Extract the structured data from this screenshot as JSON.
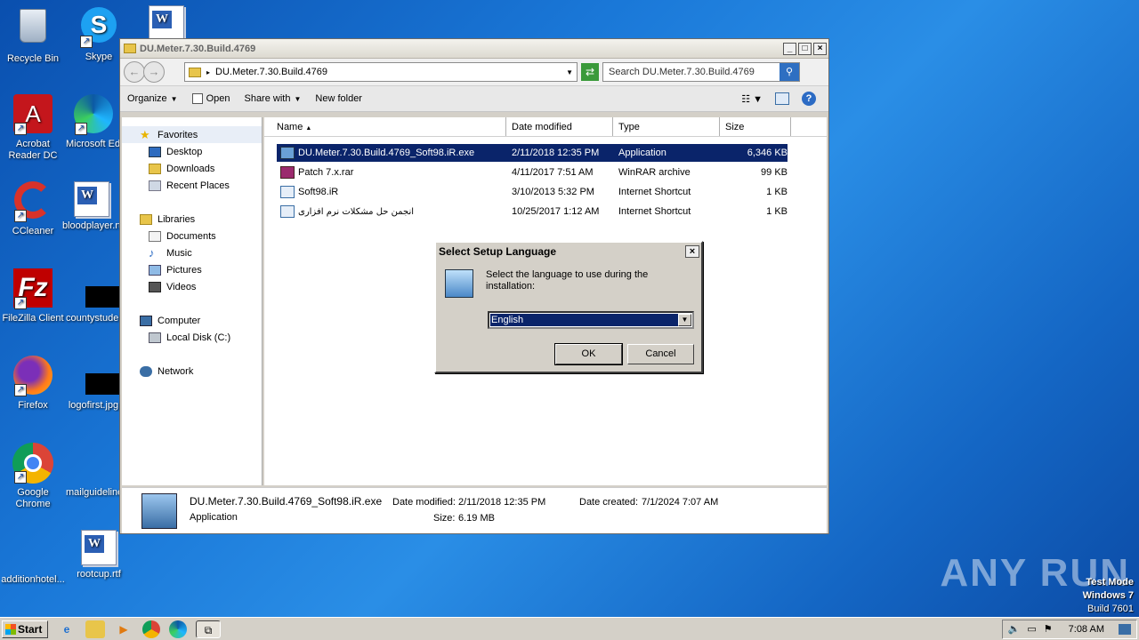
{
  "desktop": {
    "icons": [
      {
        "label": "Recycle Bin"
      },
      {
        "label": "Skype"
      },
      {
        "label": "Acrobat Reader DC"
      },
      {
        "label": "Microsoft Edge"
      },
      {
        "label": "CCleaner"
      },
      {
        "label": "bloodplayer.rtf"
      },
      {
        "label": "FileZilla Client"
      },
      {
        "label": "countystudent"
      },
      {
        "label": "Firefox"
      },
      {
        "label": "logofirst.jpg"
      },
      {
        "label": "Google Chrome"
      },
      {
        "label": "mailguidelines"
      },
      {
        "label": "additionhotel..."
      },
      {
        "label": "rootcup.rtf"
      }
    ]
  },
  "window": {
    "title": "DU.Meter.7.30.Build.4769",
    "address": "DU.Meter.7.30.Build.4769",
    "search_placeholder": "Search DU.Meter.7.30.Build.4769",
    "toolbar": {
      "organize": "Organize",
      "open": "Open",
      "share_with": "Share with",
      "new_folder": "New folder"
    },
    "nav": {
      "favorites": "Favorites",
      "desktop": "Desktop",
      "downloads": "Downloads",
      "recent": "Recent Places",
      "libraries": "Libraries",
      "documents": "Documents",
      "music": "Music",
      "pictures": "Pictures",
      "videos": "Videos",
      "computer": "Computer",
      "local_disk": "Local Disk (C:)",
      "network": "Network"
    },
    "columns": {
      "name": "Name",
      "date": "Date modified",
      "type": "Type",
      "size": "Size"
    },
    "files": [
      {
        "name": "DU.Meter.7.30.Build.4769_Soft98.iR.exe",
        "date": "2/11/2018 12:35 PM",
        "type": "Application",
        "size": "6,346 KB"
      },
      {
        "name": "Patch 7.x.rar",
        "date": "4/11/2017 7:51 AM",
        "type": "WinRAR archive",
        "size": "99 KB"
      },
      {
        "name": "Soft98.iR",
        "date": "3/10/2013 5:32 PM",
        "type": "Internet Shortcut",
        "size": "1 KB"
      },
      {
        "name": "انجمن حل مشکلات نرم افزاری",
        "date": "10/25/2017 1:12 AM",
        "type": "Internet Shortcut",
        "size": "1 KB"
      }
    ],
    "details": {
      "name": "DU.Meter.7.30.Build.4769_Soft98.iR.exe",
      "type": "Application",
      "modified_label": "Date modified:",
      "modified": "2/11/2018 12:35 PM",
      "size_label": "Size:",
      "size": "6.19 MB",
      "created_label": "Date created:",
      "created": "7/1/2024 7:07 AM"
    }
  },
  "dialog": {
    "title": "Select Setup Language",
    "message": "Select the language to use during the installation:",
    "selected_language": "English",
    "ok": "OK",
    "cancel": "Cancel"
  },
  "taskbar": {
    "start": "Start",
    "clock": "7:08 AM"
  },
  "watermark": {
    "text": "ANY RUN",
    "test_mode": "Test Mode",
    "os": "Windows 7",
    "build": "Build 7601"
  }
}
